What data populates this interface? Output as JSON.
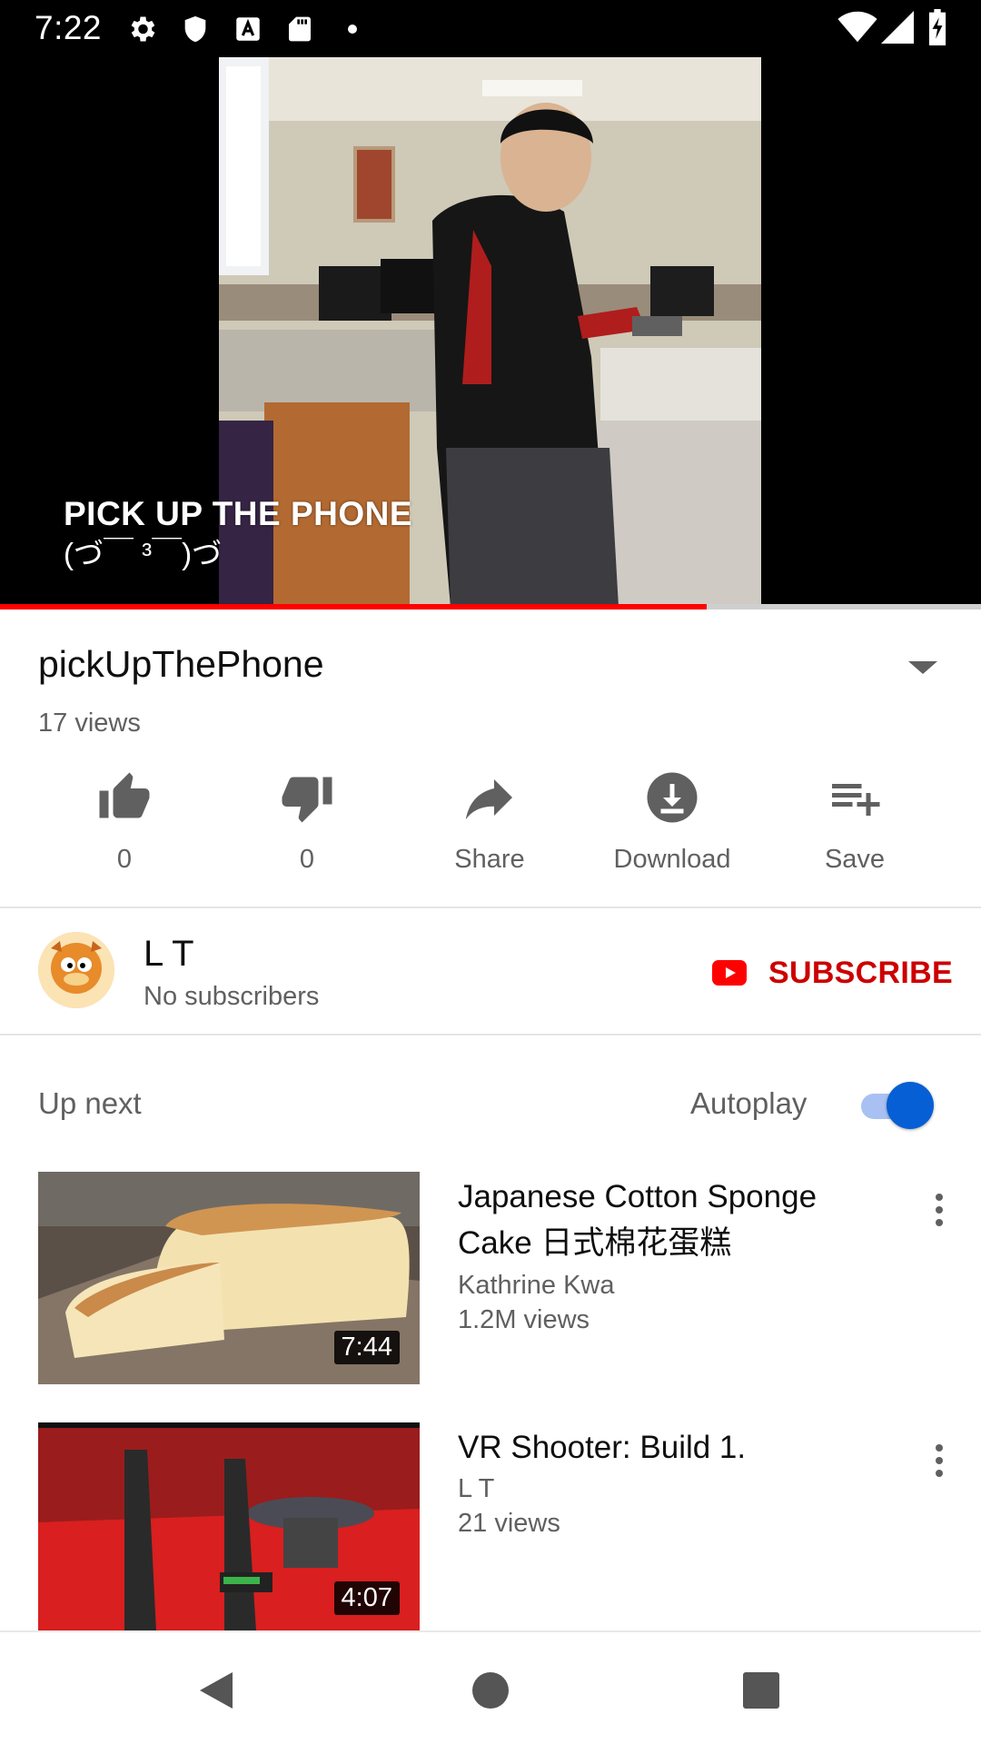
{
  "status_bar": {
    "time": "7:22",
    "icons_left": [
      "gear-icon",
      "shield-icon",
      "a-box-icon",
      "sd-card-icon",
      "dot-icon"
    ],
    "icons_right": [
      "wifi-icon",
      "signal-icon",
      "battery-charging-icon"
    ]
  },
  "video": {
    "caption_line1": "PICK UP THE PHONE",
    "caption_line2": "(づ￣ ³￣)づ",
    "progress": 0.72,
    "progress_color": "#ff0000"
  },
  "details": {
    "title": "pickUpThePhone",
    "views": "17 views"
  },
  "actions": [
    {
      "icon": "thumbs-up-icon",
      "label": "0"
    },
    {
      "icon": "thumbs-down-icon",
      "label": "0"
    },
    {
      "icon": "share-icon",
      "label": "Share"
    },
    {
      "icon": "download-icon",
      "label": "Download"
    },
    {
      "icon": "playlist-add-icon",
      "label": "Save"
    }
  ],
  "channel": {
    "name": "L T",
    "subscribers": "No subscribers",
    "subscribe_label": "SUBSCRIBE",
    "accent": "#cc0000"
  },
  "up_next": {
    "label": "Up next",
    "autoplay_label": "Autoplay",
    "autoplay_on": true,
    "videos": [
      {
        "title": "Japanese Cotton Sponge Cake 日式棉花蛋糕",
        "channel": "Kathrine Kwa",
        "views": "1.2M views",
        "duration": "7:44"
      },
      {
        "title": "VR Shooter: Build 1.",
        "channel": "L T",
        "views": "21 views",
        "duration": "4:07"
      }
    ]
  },
  "nav": {
    "buttons": [
      "back-icon",
      "home-icon",
      "recents-icon"
    ]
  }
}
